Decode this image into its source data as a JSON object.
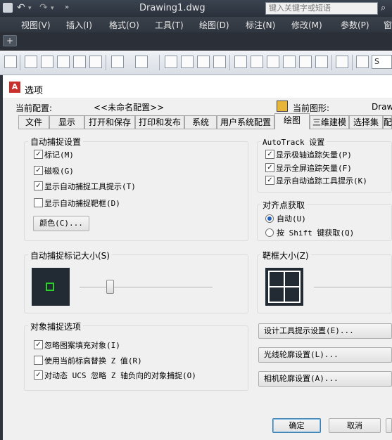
{
  "window": {
    "title": "Drawing1.dwg",
    "search_placeholder": "键入关键字或短语"
  },
  "menu": [
    "视图(V)",
    "插入(I)",
    "格式(O)",
    "工具(T)",
    "绘图(D)",
    "标注(N)",
    "修改(M)",
    "参数(P)",
    "窗"
  ],
  "toolbar": {
    "style_input": "S"
  },
  "dialog": {
    "title": "选项",
    "current_profile_label": "当前配置:",
    "current_profile_value": "<<未命名配置>>",
    "current_drawing_label": "当前图形:",
    "current_drawing_value": "Drawi",
    "tabs": [
      "文件",
      "显示",
      "打开和保存",
      "打印和发布",
      "系统",
      "用户系统配置",
      "绘图",
      "三维建模",
      "选择集",
      "配"
    ],
    "active_tab": "绘图",
    "autosnap": {
      "title": "自动捕捉设置",
      "options": [
        {
          "label": "标记(M)",
          "checked": true
        },
        {
          "label": "磁吸(G)",
          "checked": true
        },
        {
          "label": "显示自动捕捉工具提示(T)",
          "checked": true
        },
        {
          "label": "显示自动捕捉靶框(D)",
          "checked": false
        }
      ],
      "color_button": "颜色(C)..."
    },
    "marker_size": {
      "title": "自动捕捉标记大小(S)",
      "value_fraction": 0.23
    },
    "osnap_options": {
      "title": "对象捕捉选项",
      "options": [
        {
          "label": "忽略图案填充对象(I)",
          "checked": true
        },
        {
          "label": "使用当前标高替换 Z 值(R)",
          "checked": false
        },
        {
          "label": "对动态 UCS 忽略 Z 轴负向的对象捕捉(O)",
          "checked": true
        }
      ]
    },
    "autotrack": {
      "title": "AutoTrack 设置",
      "options": [
        {
          "label": "显示极轴追踪矢量(P)",
          "checked": true
        },
        {
          "label": "显示全屏追踪矢量(F)",
          "checked": true
        },
        {
          "label": "显示自动追踪工具提示(K)",
          "checked": true
        }
      ]
    },
    "alignment": {
      "title": "对齐点获取",
      "options": [
        {
          "label": "自动(U)",
          "selected": true
        },
        {
          "label": "按 Shift 键获取(Q)",
          "selected": false
        }
      ]
    },
    "aperture": {
      "title": "靶框大小(Z)"
    },
    "buttons": {
      "tooltip": "设计工具提示设置(E)...",
      "lights": "光线轮廓设置(L)...",
      "camera": "相机轮廓设置(A)...",
      "ok": "确定",
      "cancel": "取消"
    }
  }
}
